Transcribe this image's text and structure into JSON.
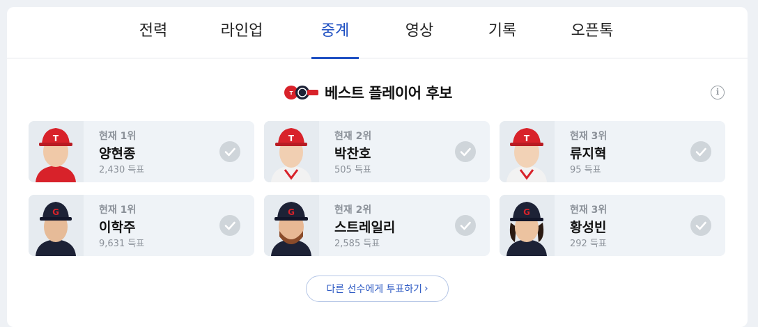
{
  "tabs": [
    {
      "label": "전력"
    },
    {
      "label": "라인업"
    },
    {
      "label": "중계"
    },
    {
      "label": "영상"
    },
    {
      "label": "기록"
    },
    {
      "label": "오픈톡"
    }
  ],
  "active_tab": "중계",
  "section": {
    "title": "베스트 플레이어 후보",
    "info_icon": "info-icon"
  },
  "players": [
    {
      "rank": "현재 1위",
      "name": "양현종",
      "votes": "2,430 득표",
      "team": "KIA"
    },
    {
      "rank": "현재 2위",
      "name": "박찬호",
      "votes": "505 득표",
      "team": "KIA"
    },
    {
      "rank": "현재 3위",
      "name": "류지혁",
      "votes": "95 득표",
      "team": "KIA"
    },
    {
      "rank": "현재 1위",
      "name": "이학주",
      "votes": "9,631 득표",
      "team": "LG"
    },
    {
      "rank": "현재 2위",
      "name": "스트레일리",
      "votes": "2,585 득표",
      "team": "LG"
    },
    {
      "rank": "현재 3위",
      "name": "황성빈",
      "votes": "292 득표",
      "team": "LG"
    }
  ],
  "vote_button": {
    "label": "다른 선수에게 투표하기",
    "arrow": "›"
  },
  "colors": {
    "accent": "#1e4fc2",
    "card_bg": "#eff3f7",
    "check": "#cfd5da",
    "kia_red": "#d8222a",
    "lg_navy": "#1d2236"
  }
}
